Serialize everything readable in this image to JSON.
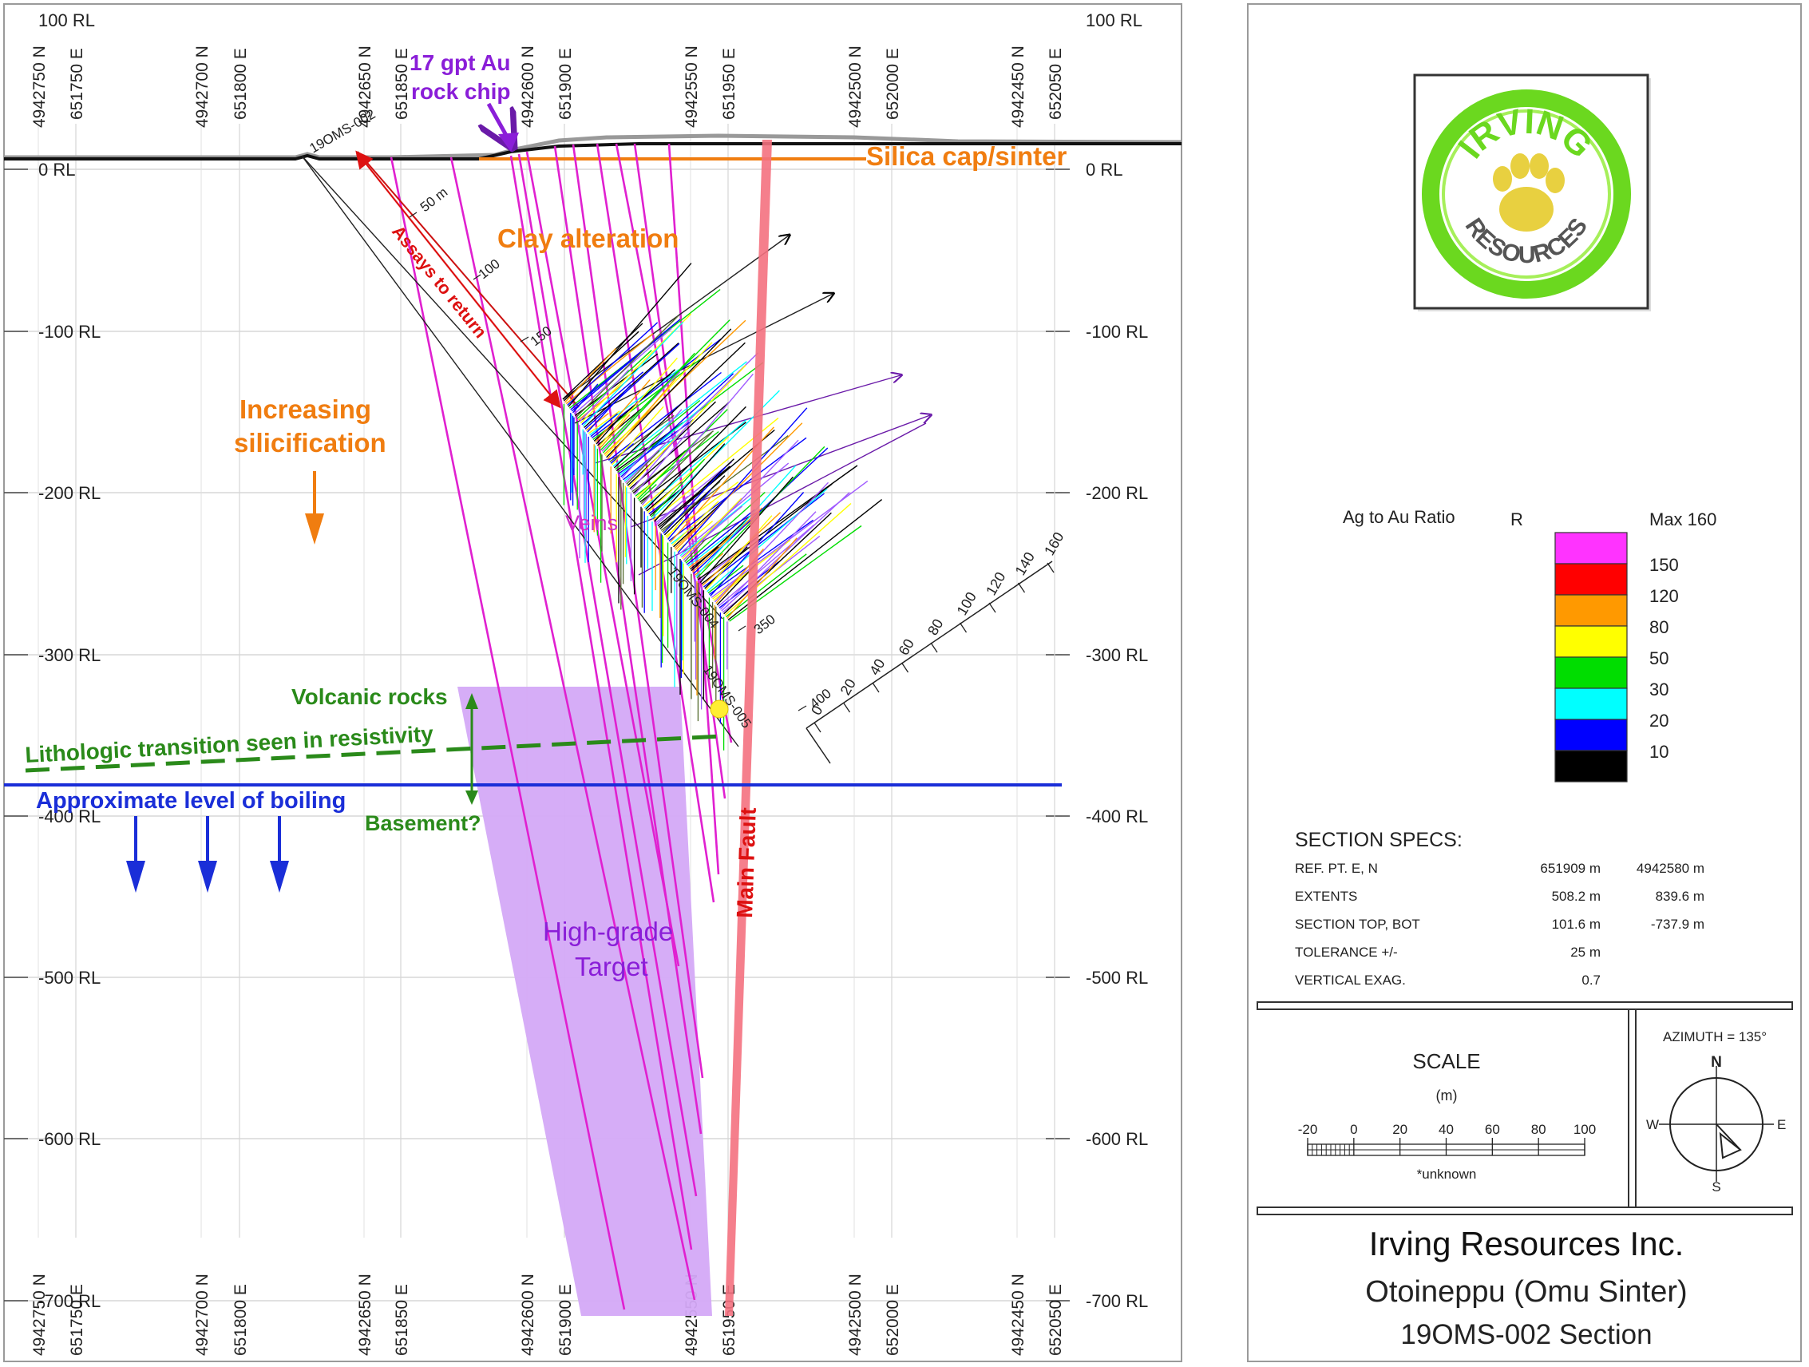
{
  "grid": {
    "rl_levels": [
      "100 RL",
      "0 RL",
      "-100 RL",
      "-200 RL",
      "-300 RL",
      "-400 RL",
      "-500 RL",
      "-600 RL",
      "-700 RL"
    ],
    "northings": [
      "4942750 N",
      "4942700 N",
      "4942650 N",
      "4942600 N",
      "4942550 N",
      "4942500 N",
      "4942450 N"
    ],
    "eastings": [
      "651750 E",
      "651800 E",
      "651850 E",
      "651900 E",
      "651950 E",
      "652000 E",
      "652050 E"
    ]
  },
  "annotations": {
    "rock_chip_line1": "17 gpt Au",
    "rock_chip_line2": "rock chip",
    "silica_cap": "Silica cap/sinter",
    "clay_alteration": "Clay alteration",
    "assays": "Assays to return",
    "increasing_line1": "Increasing",
    "increasing_line2": "silicification",
    "veins": "Veins",
    "volcanic_rocks": "Volcanic rocks",
    "lithologic": "Lithologic transition seen in resistivity",
    "boiling": "Approximate level of boiling",
    "basement": "Basement?",
    "target_line1": "High-grade",
    "target_line2": "Target",
    "main_fault": "Main Fault",
    "hole_002": "19OMS-002",
    "hole_004": "19OMS-004",
    "hole_005": "19OMS-005"
  },
  "depth_ticks": [
    "50 m",
    "100",
    "150",
    "350",
    "400"
  ],
  "histogram_scale": [
    "0",
    "20",
    "40",
    "60",
    "80",
    "100",
    "120",
    "140",
    "160"
  ],
  "legend": {
    "title": "Ag to Au Ratio",
    "column": "R",
    "max": "Max 160",
    "items": [
      {
        "label": "150",
        "color": "#ff33ff"
      },
      {
        "label": "120",
        "color": "#ff0000"
      },
      {
        "label": "80",
        "color": "#ff9900"
      },
      {
        "label": "50",
        "color": "#ffff00"
      },
      {
        "label": "30",
        "color": "#00dd00"
      },
      {
        "label": "20",
        "color": "#00ffff"
      },
      {
        "label": "10",
        "color": "#0000ff"
      },
      {
        "label": "",
        "color": "#000000"
      }
    ]
  },
  "section_specs": {
    "heading": "SECTION  SPECS:",
    "rows": [
      {
        "label": "REF. PT.  E, N",
        "v1": "651909 m",
        "v2": "4942580 m"
      },
      {
        "label": "EXTENTS",
        "v1": "508.2 m",
        "v2": "839.6 m"
      },
      {
        "label": "SECTION TOP, BOT",
        "v1": "101.6 m",
        "v2": "-737.9 m"
      },
      {
        "label": "TOLERANCE  +/-",
        "v1": "25 m",
        "v2": ""
      },
      {
        "label": "VERTICAL EXAG.",
        "v1": "0.7",
        "v2": ""
      }
    ]
  },
  "scale": {
    "title": "SCALE",
    "unit": "(m)",
    "ticks": [
      "-20",
      "0",
      "20",
      "40",
      "60",
      "80",
      "100"
    ],
    "note": "*unknown"
  },
  "compass": {
    "azimuth": "AZIMUTH = 135°",
    "n": "N",
    "s": "S",
    "e": "E",
    "w": "W"
  },
  "title_block": {
    "company": "Irving Resources Inc.",
    "project": "Otoineppu (Omu Sinter)",
    "section": "19OMS-002 Section"
  },
  "logo": {
    "text_top": "IRVING",
    "text_bottom": "RESOURCES"
  },
  "colors": {
    "fault": "#f4717f",
    "target": "#d4a9f7",
    "drill_trace": "#e020d0",
    "orange": "#f07d10",
    "green": "#2a8a1a",
    "blue": "#1a2ed8",
    "purple": "#8a1ed8",
    "red": "#dd1111"
  }
}
